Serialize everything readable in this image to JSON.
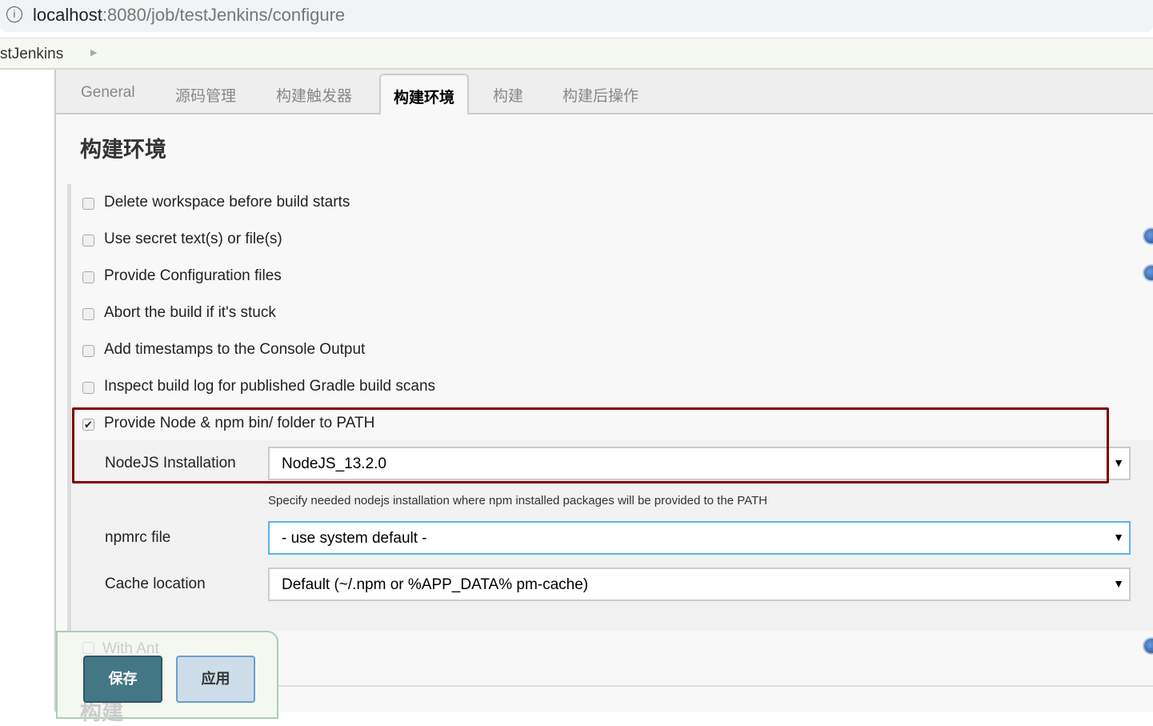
{
  "browser": {
    "host": "localhost",
    "path": ":8080/job/testJenkins/configure"
  },
  "breadcrumb": {
    "item": "stJenkins"
  },
  "tabs": [
    "General",
    "源码管理",
    "构建触发器",
    "构建环境",
    "构建",
    "构建后操作"
  ],
  "section": {
    "title": "构建环境",
    "next_title": "构建"
  },
  "options": [
    {
      "label": "Delete workspace before build starts",
      "checked": false
    },
    {
      "label": "Use secret text(s) or file(s)",
      "checked": false
    },
    {
      "label": "Provide Configuration files",
      "checked": false
    },
    {
      "label": "Abort the build if it's stuck",
      "checked": false
    },
    {
      "label": "Add timestamps to the Console Output",
      "checked": false
    },
    {
      "label": "Inspect build log for published Gradle build scans",
      "checked": false
    },
    {
      "label": "Provide Node & npm bin/ folder to PATH",
      "checked": true
    }
  ],
  "node": {
    "installation_label": "NodeJS Installation",
    "installation_value": "NodeJS_13.2.0",
    "hint": "Specify needed nodejs installation where npm installed packages will be provided to the PATH",
    "npmrc_label": "npmrc file",
    "npmrc_value": "- use system default -",
    "cache_label": "Cache location",
    "cache_value": "Default (~/.npm or %APP_DATA% pm-cache)"
  },
  "with_ant": "With Ant",
  "buttons": {
    "save": "保存",
    "apply": "应用"
  }
}
